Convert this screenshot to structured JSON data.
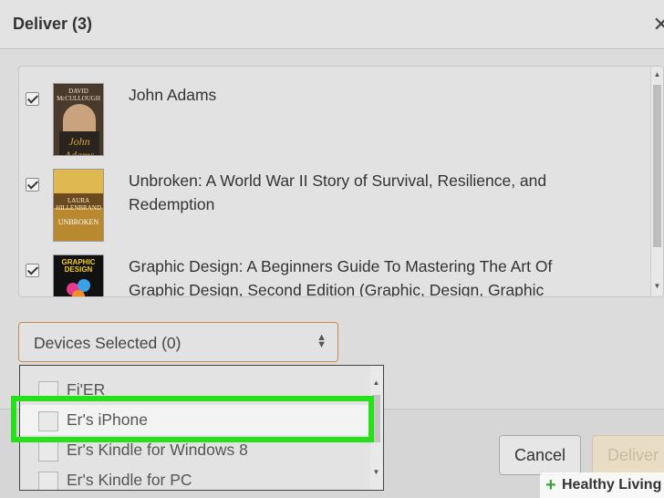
{
  "dialog": {
    "title": "Deliver (3)",
    "close_glyph": "✕"
  },
  "books": [
    {
      "title": "John Adams",
      "checked": true,
      "cover": {
        "author": "DAVID McCULLOUGH",
        "script": "John Adams",
        "bg": "#4a3a2e"
      }
    },
    {
      "title": "Unbroken: A World War II Story of Survival, Resilience, and Redemption",
      "checked": true,
      "cover": {
        "author": "LAURA HILLENBRAND",
        "title": "UNBROKEN",
        "bg": "#b8892e"
      }
    },
    {
      "title": "Graphic Design: A Beginners Guide To Mastering The Art Of Graphic Design, Second Edition (Graphic, Design, Graphic",
      "checked": true,
      "cover": {
        "title": "GRAPHIC DESIGN",
        "bg": "#111111"
      }
    }
  ],
  "devices_select": {
    "label": "Devices Selected (0)"
  },
  "devices": [
    {
      "label": "Fi'ER",
      "checked": false
    },
    {
      "label": "Er's iPhone",
      "checked": false,
      "highlighted": true
    },
    {
      "label": "Er's Kindle for Windows 8",
      "checked": false
    },
    {
      "label": "Er's Kindle for PC",
      "checked": false
    }
  ],
  "footer": {
    "cancel_label": "Cancel",
    "deliver_label": "Deliver"
  },
  "watermark": {
    "brand": "Healthy Living"
  },
  "colors": {
    "highlight": "#26e01a",
    "select_border": "#c88a50",
    "deliver_disabled_bg": "#e8dcc4"
  }
}
